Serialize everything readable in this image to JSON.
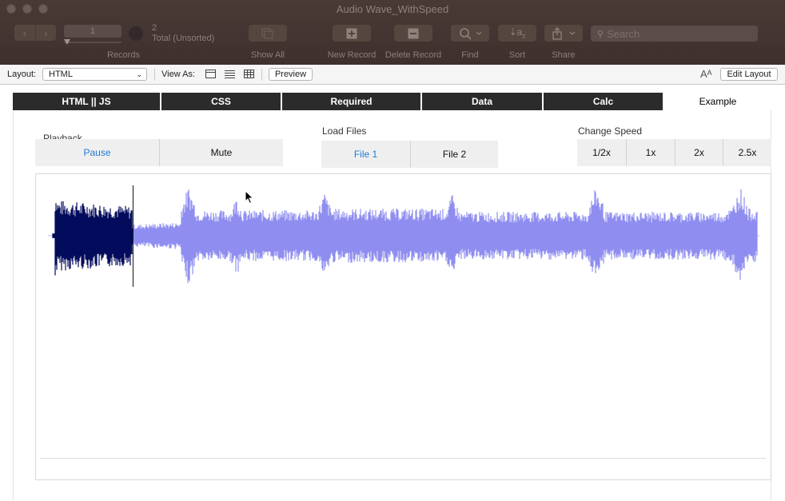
{
  "window": {
    "title": "Audio Wave_WithSpeed"
  },
  "toolbar": {
    "record_number": "1",
    "found_count": "2",
    "total_text": "Total (Unsorted)",
    "records_label": "Records",
    "show_all_label": "Show All",
    "new_record_label": "New Record",
    "delete_record_label": "Delete Record",
    "find_label": "Find",
    "sort_label": "Sort",
    "share_label": "Share",
    "search_placeholder": "Search"
  },
  "layoutbar": {
    "layout_label": "Layout:",
    "layout_value": "HTML",
    "view_as_label": "View As:",
    "preview_label": "Preview",
    "edit_layout_label": "Edit Layout"
  },
  "tabs": [
    {
      "label": "HTML || JS",
      "active": false
    },
    {
      "label": "CSS",
      "active": false
    },
    {
      "label": "Required",
      "active": false
    },
    {
      "label": "Data",
      "active": false
    },
    {
      "label": "Calc",
      "active": false
    },
    {
      "label": "Example",
      "active": true
    }
  ],
  "playback": {
    "label": "Playback",
    "buttons": [
      {
        "label": "Pause",
        "selected": true
      },
      {
        "label": "Mute",
        "selected": false
      }
    ]
  },
  "load_files": {
    "label": "Load Files",
    "buttons": [
      {
        "label": "File 1",
        "selected": true
      },
      {
        "label": "File 2",
        "selected": false
      }
    ]
  },
  "change_speed": {
    "label": "Change Speed",
    "buttons": [
      {
        "label": "1/2x",
        "selected": false
      },
      {
        "label": "1x",
        "selected": false
      },
      {
        "label": "2x",
        "selected": false
      },
      {
        "label": "2.5x",
        "selected": false
      }
    ]
  },
  "waveform": {
    "played_color": "#030b5c",
    "unplayed_color": "#8f8ef0",
    "progress": 0.114
  }
}
